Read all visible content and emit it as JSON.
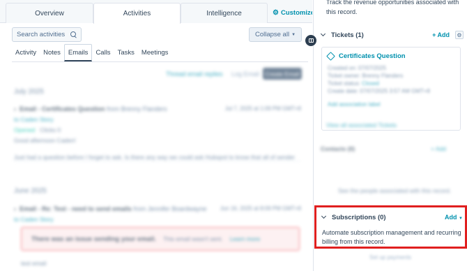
{
  "tabs": {
    "overview": "Overview",
    "activities": "Activities",
    "intelligence": "Intelligence",
    "customize": "Customize"
  },
  "search": {
    "placeholder": "Search activities"
  },
  "collapse_label": "Collapse all",
  "subtabs": [
    "Activity",
    "Notes",
    "Emails",
    "Calls",
    "Tasks",
    "Meetings"
  ],
  "active_subtab": "Emails",
  "email_toolbar": {
    "thread_link": "Thread email replies",
    "log_email": "Log Email",
    "create_email": "Create Email"
  },
  "timeline": {
    "month_1": "July 2025",
    "email_1": {
      "title": "Email - Certificates Question",
      "from": "from Brenny Flanders",
      "date": "Jul 7, 2025 at 1:09 PM GMT+8",
      "to": "to Caden Story",
      "status": "Opened",
      "count": "Clicks 0",
      "greeting": "Good afternoon Caden!",
      "preview": "Just had a question before I forget to ask. Is there any way we could ask Hubspot to know that all of sender"
    },
    "month_2": "June 2025",
    "email_2": {
      "title": "Email - Re: Test - need to send emails",
      "from": "from Jennifer Boardwayne",
      "date": "Jun 16, 2025 at 8:09 PM GMT+8",
      "to": "to Caden Story"
    },
    "error": {
      "title": "There was an issue sending your email.",
      "sub": "This email wasn't sent.",
      "link": "Learn more"
    },
    "trailing": "test email"
  },
  "sidebar": {
    "top_text": "Track the revenue opportunities associated with this record.",
    "tickets": {
      "title": "Tickets (1)",
      "add": "+ Add",
      "card_title": "Certificates Question",
      "created": "Created on: 07/07/2025",
      "owner": "Ticket owner: Brenny Flanders",
      "status_label": "Ticket status:",
      "status_value": "Closed",
      "create_date": "Create date: 07/07/2025 3:57 AM GMT+8",
      "association_link": "Add association label",
      "view_all": "View all associated Tickets"
    },
    "contacts": {
      "title": "Contacts (0)",
      "add": "+ Add",
      "empty": "See the people associated with this record."
    },
    "subscriptions": {
      "title": "Subscriptions (0)",
      "add": "Add",
      "description": "Automate subscription management and recurring billing from this record."
    },
    "bottom_text": "Set up payments"
  },
  "colors": {
    "accent": "#0091ae",
    "highlight": "#e01f1f",
    "text": "#33475b"
  }
}
